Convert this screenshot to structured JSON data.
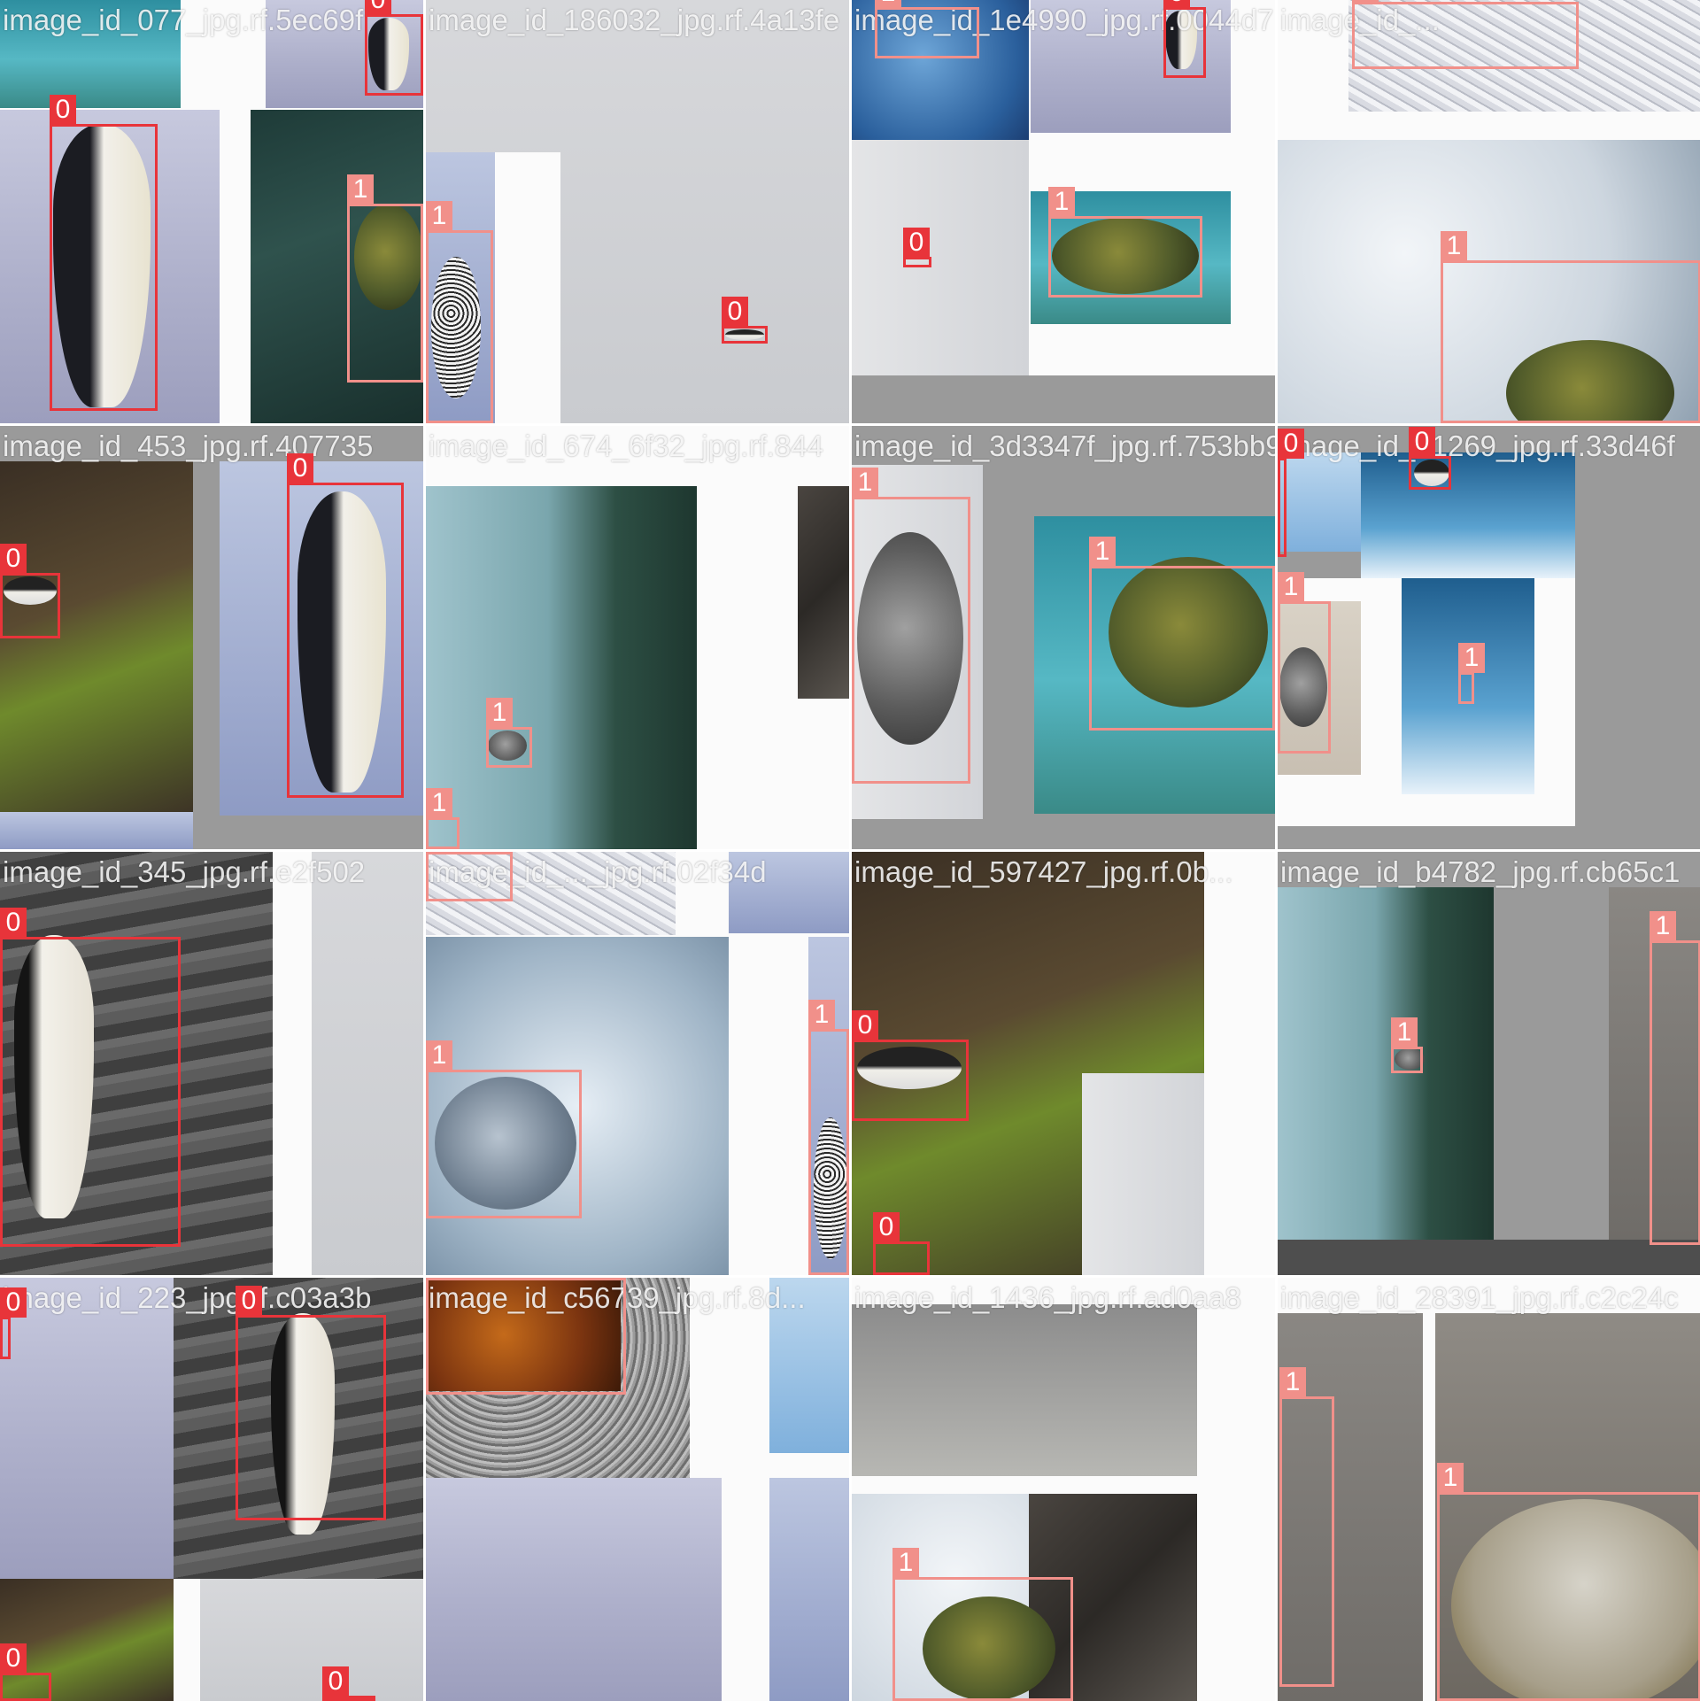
{
  "mosaic": {
    "tiles": [
      {
        "file_label": "image_id_077_jpg.rf.5ec69f"
      },
      {
        "file_label": "image_id_186032_jpg.rf.4a13fe"
      },
      {
        "file_label": "image_id_1e4990_jpg.rf.0044d7"
      },
      {
        "file_label": "image_id_..."
      },
      {
        "file_label": "image_id_453_jpg.rf.407735"
      },
      {
        "file_label": "image_id_674_6f32_jpg.rf.844"
      },
      {
        "file_label": "image_id_3d3347f_jpg.rf.753bb9"
      },
      {
        "file_label": "image_id_21269_jpg.rf.33d46f"
      },
      {
        "file_label": "image_id_345_jpg.rf.e2f502"
      },
      {
        "file_label": "image_id_..._jpg.rf.02f34d"
      },
      {
        "file_label": "image_id_597427_jpg.rf.0b..."
      },
      {
        "file_label": "image_id_b4782_jpg.rf.cb65c1"
      },
      {
        "file_label": "image_id_223_jpg.rf.c03a3b"
      },
      {
        "file_label": "image_id_c56739_jpg.rf.8d..."
      },
      {
        "file_label": "image_id_1436_jpg.rf.ad0aa8"
      },
      {
        "file_label": "image_id_28391_jpg.rf.c2c24c"
      }
    ]
  },
  "class_ids": {
    "penguin": "0",
    "turtle": "1"
  },
  "colors": {
    "class_0": "#e8343a",
    "class_1": "#f1908a",
    "filename_text": "#ffffff"
  }
}
